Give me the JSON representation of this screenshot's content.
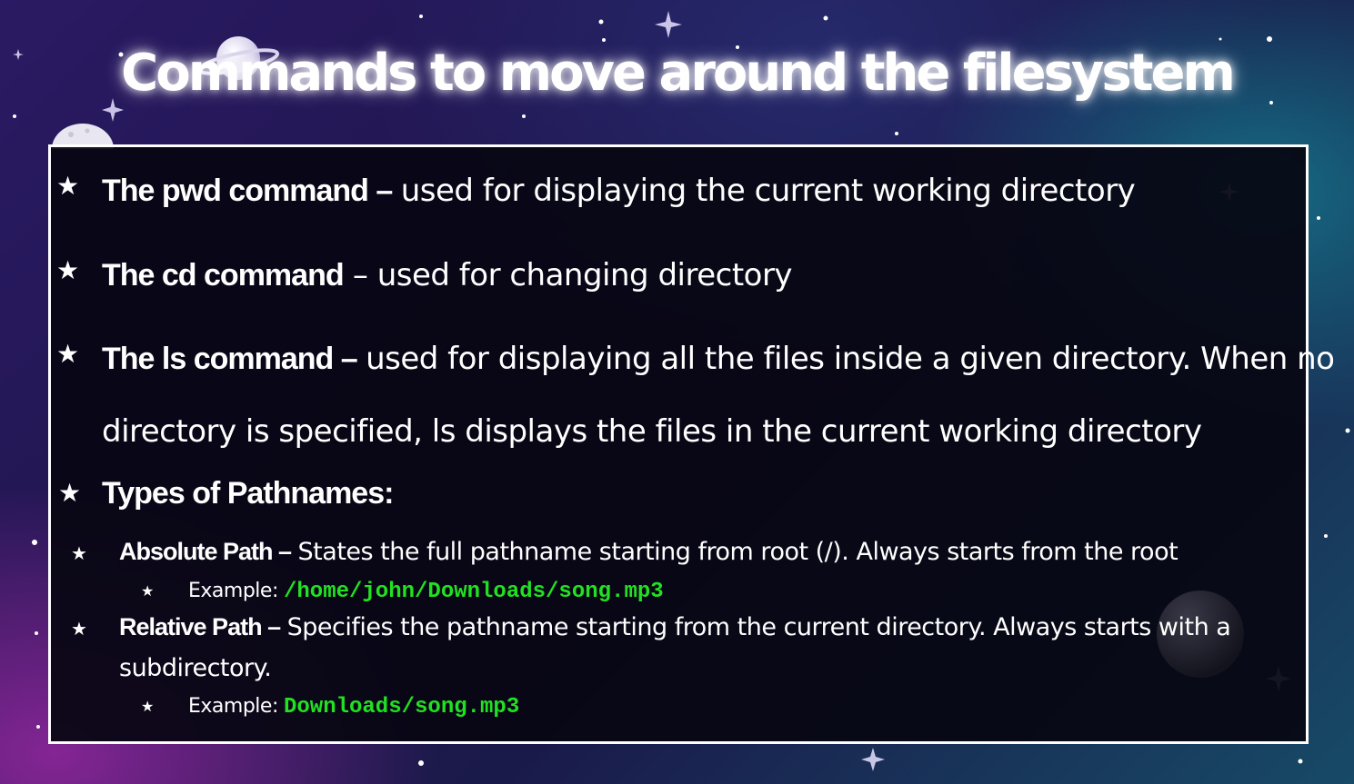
{
  "slide": {
    "title": "Commands to move around the filesystem"
  },
  "bullets": [
    {
      "star": "★",
      "term": "The pwd command –",
      "desc": "used for displaying the current working directory"
    },
    {
      "star": "★",
      "term": "The cd command",
      "desc": " – used for changing directory"
    },
    {
      "star": "★",
      "term": "The ls command –",
      "desc": "used for displaying all the files inside a given directory. When no",
      "desc_cont": "directory is specified, ls displays the files in the current working directory"
    },
    {
      "star": "★",
      "term": "Types of Pathnames:"
    }
  ],
  "pathnames": [
    {
      "star": "★",
      "term": "Absolute Path –",
      "desc": "States the full pathname starting from root (/). Always starts from the root",
      "example_star": "★",
      "example_label": "Example:",
      "example_code": "/home/john/Downloads/song.mp3"
    },
    {
      "star": "★",
      "term": "Relative Path –",
      "desc": "Specifies the pathname starting from the current directory. Always starts with a",
      "desc_cont": "subdirectory.",
      "example_star": "★",
      "example_label": "Example:",
      "example_code": "Downloads/song.mp3"
    }
  ],
  "colors": {
    "code_green": "#22e022",
    "panel_border": "#ffffff",
    "panel_background": "#08060f"
  },
  "decor": {
    "planet_icon": "ringed-planet-icon",
    "moon_icon": "moon-icon",
    "star_icon": "sparkle-star-icon"
  }
}
